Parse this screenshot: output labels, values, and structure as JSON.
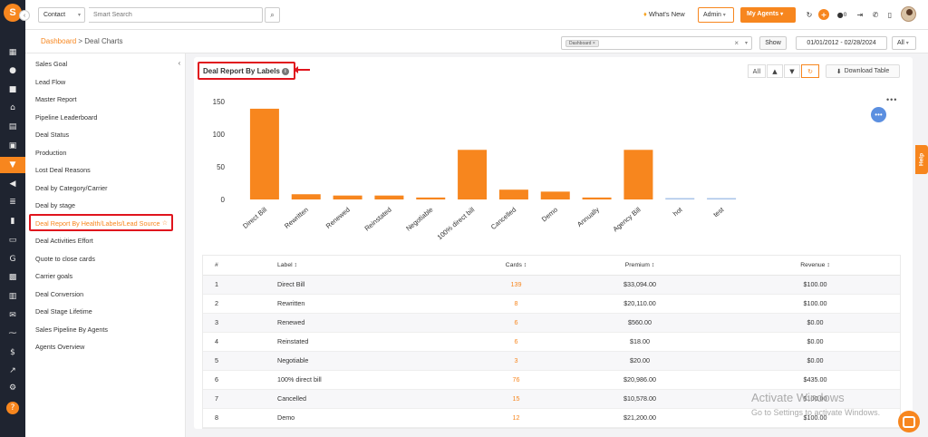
{
  "topbar": {
    "contact_select": "Contact",
    "search_placeholder": "Smart Search",
    "whats_new": "What's New",
    "admin_select": "Admin",
    "my_agents": "My Agents",
    "notification_count": "0"
  },
  "subheader": {
    "breadcrumb_link": "Dashboard",
    "breadcrumb_current": "> Deal Charts",
    "filter_chip": "Dashboard",
    "show_button": "Show",
    "date_range": "01/01/2012 - 02/28/2024",
    "all_select": "All"
  },
  "sidebar": {
    "items": [
      "Sales Goal",
      "Lead Flow",
      "Master Report",
      "Pipeline Leaderboard",
      "Deal Status",
      "Production",
      "Lost Deal Reasons",
      "Deal by Category/Carrier",
      "Deal by stage",
      "Deal Report By Health/Labels/Lead Source",
      "Deal Activities Effort",
      "Quote to close cards",
      "Carrier goals",
      "Deal Conversion",
      "Deal Stage Lifetime",
      "Sales Pipeline By Agents",
      "Agents Overview"
    ]
  },
  "report": {
    "title": "Deal Report By Labels",
    "toggle_all": "All",
    "download": "Download Table"
  },
  "chart_data": {
    "type": "bar",
    "title": "",
    "xlabel": "",
    "ylabel": "",
    "ylim": [
      0,
      150
    ],
    "yticks": [
      0,
      50,
      100,
      150
    ],
    "categories": [
      "Direct Bill",
      "Rewritten",
      "Renewed",
      "Reinstated",
      "Negotiable",
      "100% direct bill",
      "Cancelled",
      "Demo",
      "Annually",
      "Agency Bill",
      "hot",
      "test"
    ],
    "values": [
      139,
      8,
      6,
      6,
      3,
      76,
      15,
      12,
      3,
      76,
      1,
      1
    ],
    "colors": {
      "bar": "#f7861e",
      "small_bar": "#a9c4e8"
    }
  },
  "table": {
    "headers": [
      "#",
      "Label ↕",
      "Cards ↕",
      "Premium ↕",
      "Revenue ↕"
    ],
    "rows": [
      [
        "1",
        "Direct Bill",
        "139",
        "$33,094.00",
        "$100.00"
      ],
      [
        "2",
        "Rewritten",
        "8",
        "$20,110.00",
        "$100.00"
      ],
      [
        "3",
        "Renewed",
        "6",
        "$560.00",
        "$0.00"
      ],
      [
        "4",
        "Reinstated",
        "6",
        "$18.00",
        "$0.00"
      ],
      [
        "5",
        "Negotiable",
        "3",
        "$20.00",
        "$0.00"
      ],
      [
        "6",
        "100% direct bill",
        "76",
        "$20,986.00",
        "$435.00"
      ],
      [
        "7",
        "Cancelled",
        "15",
        "$10,578.00",
        "$100.00"
      ],
      [
        "8",
        "Demo",
        "12",
        "$21,200.00",
        "$100.00"
      ]
    ]
  },
  "help_tab": "Help",
  "watermark": {
    "line1": "Activate Windows",
    "line2": "Go to Settings to activate Windows."
  },
  "icons": [
    "logo",
    "dashboard-icon",
    "user-icon",
    "folder-icon",
    "bank-icon",
    "document-icon",
    "contact-card-icon",
    "filter-icon",
    "megaphone-icon",
    "list-icon",
    "chart-icon",
    "folder-open-icon",
    "google-icon",
    "grid-icon",
    "calendar-icon",
    "mail-icon",
    "handshake-icon",
    "dollar-icon",
    "trend-icon",
    "settings-icon",
    "help-icon"
  ]
}
